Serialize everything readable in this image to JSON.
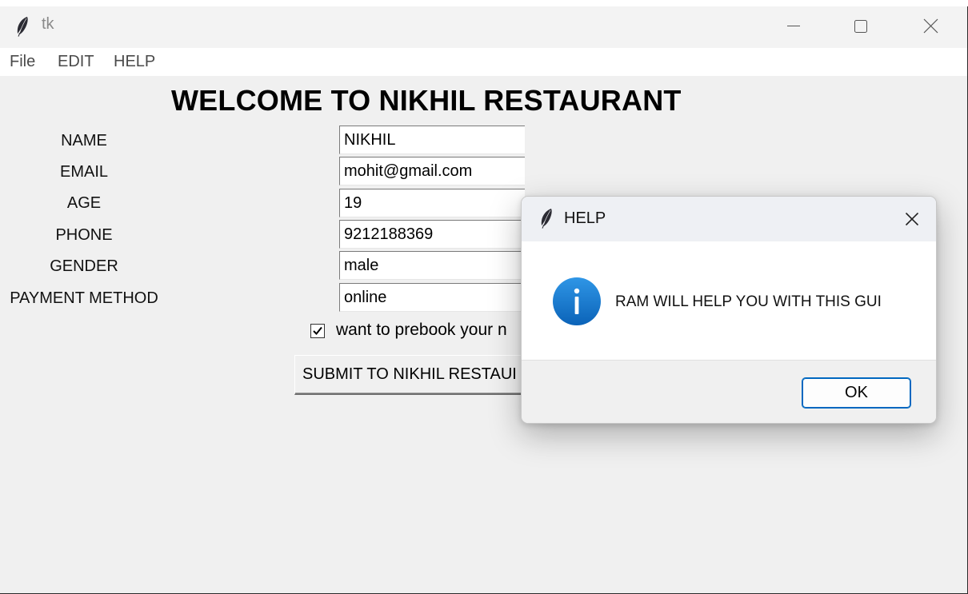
{
  "window": {
    "title": "tk",
    "controls": {
      "minimize_icon": "minimize-icon",
      "maximize_icon": "maximize-icon",
      "close_icon": "close-icon"
    }
  },
  "menubar": {
    "items": [
      "File",
      "EDIT",
      "HELP"
    ]
  },
  "form": {
    "heading": "WELCOME TO NIKHIL RESTAURANT",
    "fields": [
      {
        "label": "NAME",
        "value": "NIKHIL"
      },
      {
        "label": "EMAIL",
        "value": "mohit@gmail.com"
      },
      {
        "label": "AGE",
        "value": "19"
      },
      {
        "label": "PHONE",
        "value": "9212188369"
      },
      {
        "label": "GENDER",
        "value": "male"
      },
      {
        "label": "PAYMENT METHOD",
        "value": "online"
      }
    ],
    "checkbox": {
      "label": "want to prebook your n",
      "checked": true
    },
    "submit_label": "SUBMIT TO NIKHIL RESTAUI"
  },
  "dialog": {
    "title": "HELP",
    "icon": "info-icon",
    "message": "RAM WILL HELP YOU WITH THIS GUI",
    "ok_label": "OK",
    "accent_color": "#0067c0"
  },
  "colors": {
    "window_bg": "#f0f0f0",
    "info_icon": "#1a7fd4"
  }
}
